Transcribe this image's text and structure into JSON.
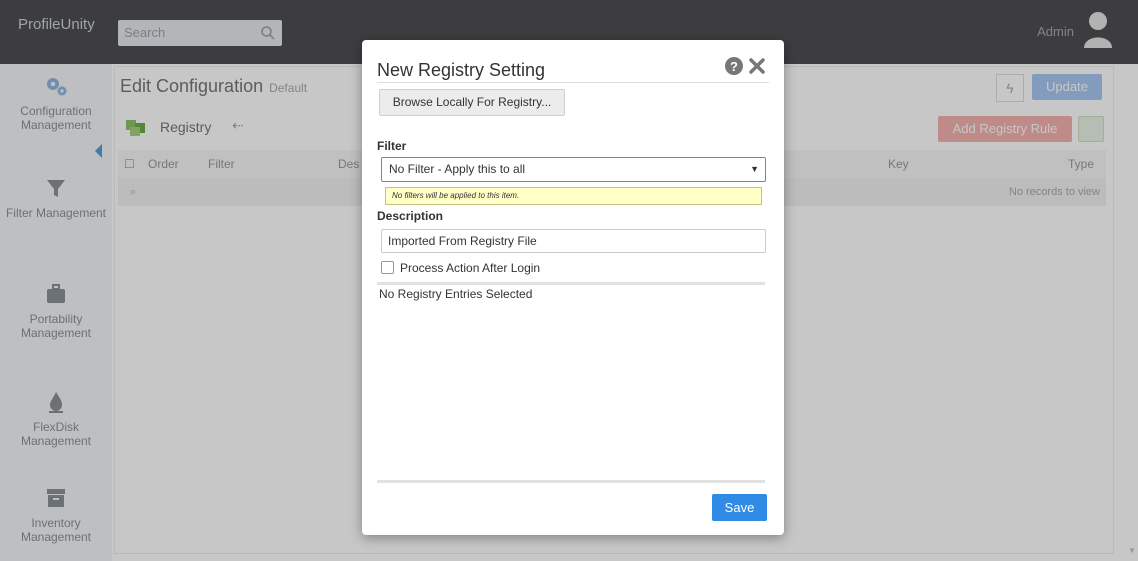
{
  "app": {
    "title": "ProfileUnity",
    "search_placeholder": "Search",
    "user": "Admin"
  },
  "sidebar": {
    "items": [
      {
        "label": "Configuration Management",
        "icon": "cogs-icon"
      },
      {
        "label": "Filter Management",
        "icon": "funnel-icon"
      },
      {
        "label": "Portability Management",
        "icon": "briefcase-icon"
      },
      {
        "label": "FlexDisk Management",
        "icon": "flame-icon"
      },
      {
        "label": "Inventory Management",
        "icon": "archive-icon"
      }
    ]
  },
  "main": {
    "title": "Edit Configuration",
    "subtitle": "Default",
    "update_label": "Update",
    "section": "Registry",
    "add_rule_label": "Add Registry Rule",
    "columns": [
      "Order",
      "Filter",
      "Des",
      "Key",
      "Type"
    ],
    "empty_text": "No records to view"
  },
  "modal": {
    "title": "New Registry Setting",
    "browse_label": "Browse Locally For Registry...",
    "filter_label": "Filter",
    "filter_value": "No Filter - Apply this to all",
    "filter_hint": "No filters will be applied to this item.",
    "description_label": "Description",
    "description_value": "Imported From Registry File",
    "process_label": "Process Action After Login",
    "entries_text": "No Registry Entries Selected",
    "save_label": "Save"
  },
  "colors": {
    "accent": "#2f8be6",
    "topbar": "#4f4f52",
    "danger_faded": "#f4b3b0"
  }
}
